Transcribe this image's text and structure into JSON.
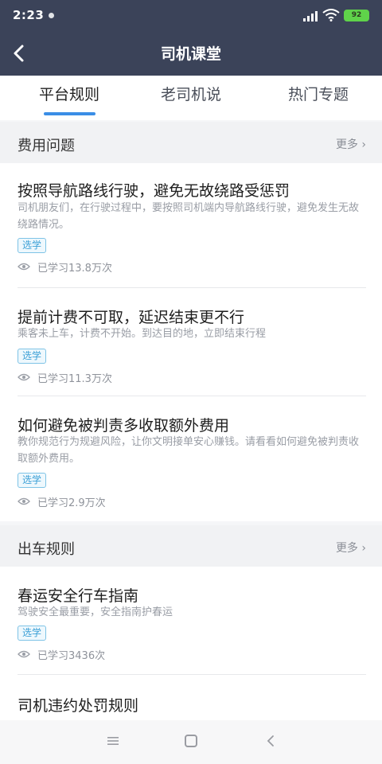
{
  "status_bar": {
    "time": "2:23",
    "battery": "92"
  },
  "header": {
    "title": "司机课堂"
  },
  "tabs": [
    {
      "label": "平台规则",
      "active": true
    },
    {
      "label": "老司机说",
      "active": false
    },
    {
      "label": "热门专题",
      "active": false
    }
  ],
  "sections": [
    {
      "title": "费用问题",
      "more": "更多",
      "items": [
        {
          "title": "按照导航路线行驶，避免无故绕路受惩罚",
          "desc": "司机朋友们，在行驶过程中，要按照司机端内导航路线行驶，避免发生无故绕路情况。",
          "tag": "选学",
          "views": "已学习13.8万次"
        },
        {
          "title": "提前计费不可取，延迟结束更不行",
          "desc": "乘客未上车，计费不开始。到达目的地，立即结束行程",
          "tag": "选学",
          "views": "已学习11.3万次"
        },
        {
          "title": "如何避免被判责多收取额外费用",
          "desc": "教你规范行为规避风险，让你文明接单安心赚钱。请看看如何避免被判责收取额外费用。",
          "tag": "选学",
          "views": "已学习2.9万次"
        }
      ]
    },
    {
      "title": "出车规则",
      "more": "更多",
      "items": [
        {
          "title": "春运安全行车指南",
          "desc": "驾驶安全最重要，安全指南护春运",
          "tag": "选学",
          "views": "已学习3436次"
        },
        {
          "title": "司机违约处罚规则"
        }
      ]
    }
  ],
  "colors": {
    "header_bg": "#3b4359",
    "accent": "#3a8ee6",
    "tag_border": "#7ec3e6"
  }
}
